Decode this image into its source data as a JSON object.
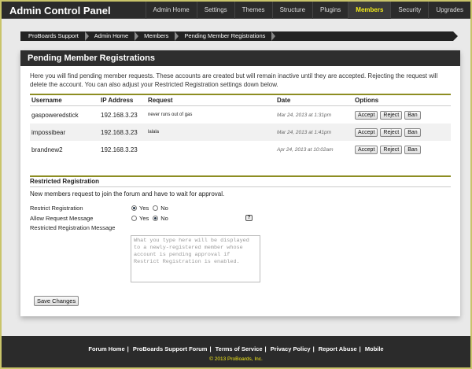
{
  "app": {
    "title": "Admin Control Panel"
  },
  "topnav": [
    {
      "label": "Admin Home",
      "active": false
    },
    {
      "label": "Settings",
      "active": false
    },
    {
      "label": "Themes",
      "active": false
    },
    {
      "label": "Structure",
      "active": false
    },
    {
      "label": "Plugins",
      "active": false
    },
    {
      "label": "Members",
      "active": true
    },
    {
      "label": "Security",
      "active": false
    },
    {
      "label": "Upgrades",
      "active": false
    }
  ],
  "breadcrumb": [
    "ProBoards Support",
    "Admin Home",
    "Members",
    "Pending Member Registrations"
  ],
  "panel": {
    "title": "Pending Member Registrations",
    "intro": "Here you will find pending member requests. These accounts are created but will remain inactive until they are accepted. Rejecting the request will delete the account. You can also adjust your Restricted Registration settings down below."
  },
  "table": {
    "headers": {
      "username": "Username",
      "ip": "IP Address",
      "request": "Request",
      "date": "Date",
      "options": "Options"
    },
    "rows": [
      {
        "username": "gaspoweredstick",
        "ip": "192.168.3.23",
        "request": "never runs out of gas",
        "date": "Mar 24, 2013 at 1:31pm"
      },
      {
        "username": "impossibear",
        "ip": "192.168.3.23",
        "request": "lalala",
        "date": "Mar 24, 2013 at 1:41pm"
      },
      {
        "username": "brandnew2",
        "ip": "192.168.3.23",
        "request": "",
        "date": "Apr 24, 2013 at 10:02am"
      }
    ],
    "buttons": {
      "accept": "Accept",
      "reject": "Reject",
      "ban": "Ban"
    }
  },
  "restricted": {
    "heading": "Restricted Registration",
    "description": "New members request to join the forum and have to wait for approval.",
    "restrict_label": "Restrict Registration",
    "restrict_value": "Yes",
    "allow_label": "Allow Request Message",
    "allow_value": "No",
    "yes": "Yes",
    "no": "No",
    "help": "?",
    "message_label": "Restricted Registration Message",
    "message_placeholder": "What you type here will be displayed to a newly-registered member whose account is pending approval if Restrict Registration is enabled.",
    "save": "Save Changes"
  },
  "footer": {
    "links": [
      "Forum Home",
      "ProBoards Support Forum",
      "Terms of Service",
      "Privacy Policy",
      "Report Abuse",
      "Mobile"
    ],
    "copyright": "© 2013 ProBoards, Inc."
  },
  "colors": {
    "accent": "#f2ea1b",
    "rule": "#8d8d22",
    "dark": "#2b2b2b"
  }
}
